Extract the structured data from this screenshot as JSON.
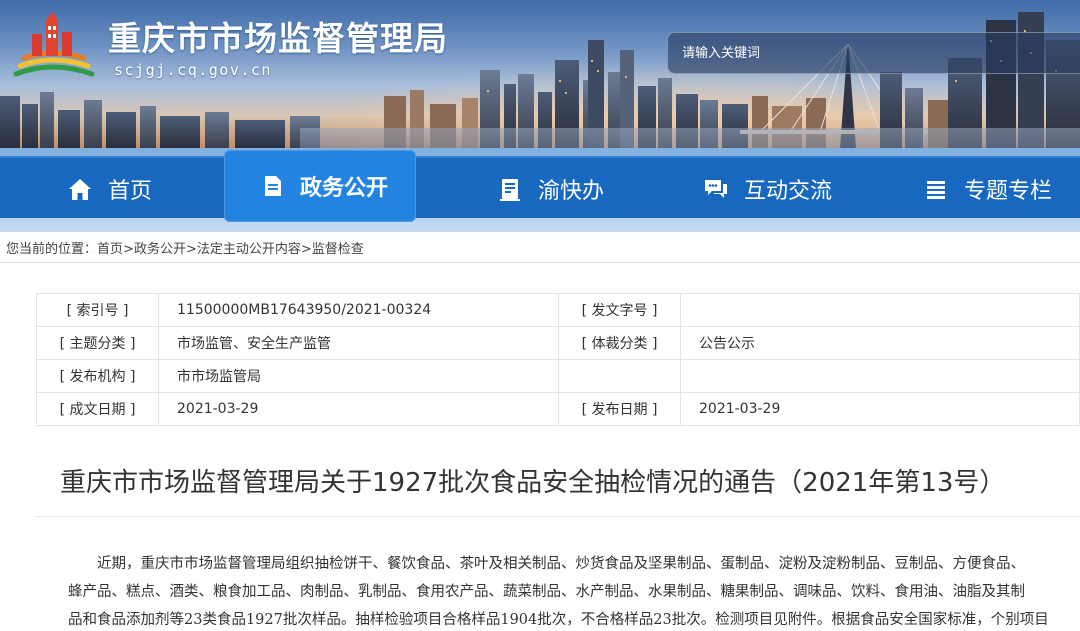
{
  "header": {
    "site_title": "重庆市市场监督管理局",
    "site_domain": "scjgj.cq.gov.cn",
    "search_placeholder": "请输入关键词"
  },
  "nav": {
    "items": [
      {
        "label": "首页",
        "icon": "home-icon"
      },
      {
        "label": "政务公开",
        "icon": "document-icon",
        "active": true
      },
      {
        "label": "渝快办",
        "icon": "id-card-icon"
      },
      {
        "label": "互动交流",
        "icon": "chat-icon"
      },
      {
        "label": "专题专栏",
        "icon": "list-icon"
      }
    ]
  },
  "breadcrumb": {
    "prefix": "您当前的位置：",
    "items": [
      "首页",
      "政务公开",
      "法定主动公开内容",
      "监督检查"
    ],
    "separator": ">"
  },
  "info": {
    "rows": [
      {
        "label1": "[ 索引号 ]",
        "value1": "11500000MB17643950/2021-00324",
        "label2": "[ 发文字号 ]",
        "value2": ""
      },
      {
        "label1": "[ 主题分类 ]",
        "value1": "市场监管、安全生产监管",
        "label2": "[ 体裁分类 ]",
        "value2": "公告公示"
      },
      {
        "label1": "[ 发布机构 ]",
        "value1": "市市场监管局",
        "label2": "",
        "value2": ""
      },
      {
        "label1": "[ 成文日期 ]",
        "value1": "2021-03-29",
        "label2": "[ 发布日期 ]",
        "value2": "2021-03-29"
      }
    ]
  },
  "article": {
    "title": "重庆市市场监督管理局关于1927批次食品安全抽检情况的通告（2021年第13号）",
    "lines": [
      "近期，重庆市市场监督管理局组织抽检饼干、餐饮食品、茶叶及相关制品、炒货食品及坚果制品、蛋制品、淀粉及淀粉制品、豆制品、方便食品、",
      "蜂产品、糕点、酒类、粮食加工品、肉制品、乳制品、食用农产品、蔬菜制品、水产制品、水果制品、糖果制品、调味品、饮料、食用油、油脂及其制",
      "品和食品添加剂等23类食品1927批次样品。抽样检验项目合格样品1904批次，不合格样品23批次。检测项目见附件。根据食品安全国家标准，个别项目"
    ]
  },
  "colors": {
    "nav_blue": "#1868c0",
    "nav_active": "#2284e0",
    "text": "#333333"
  }
}
